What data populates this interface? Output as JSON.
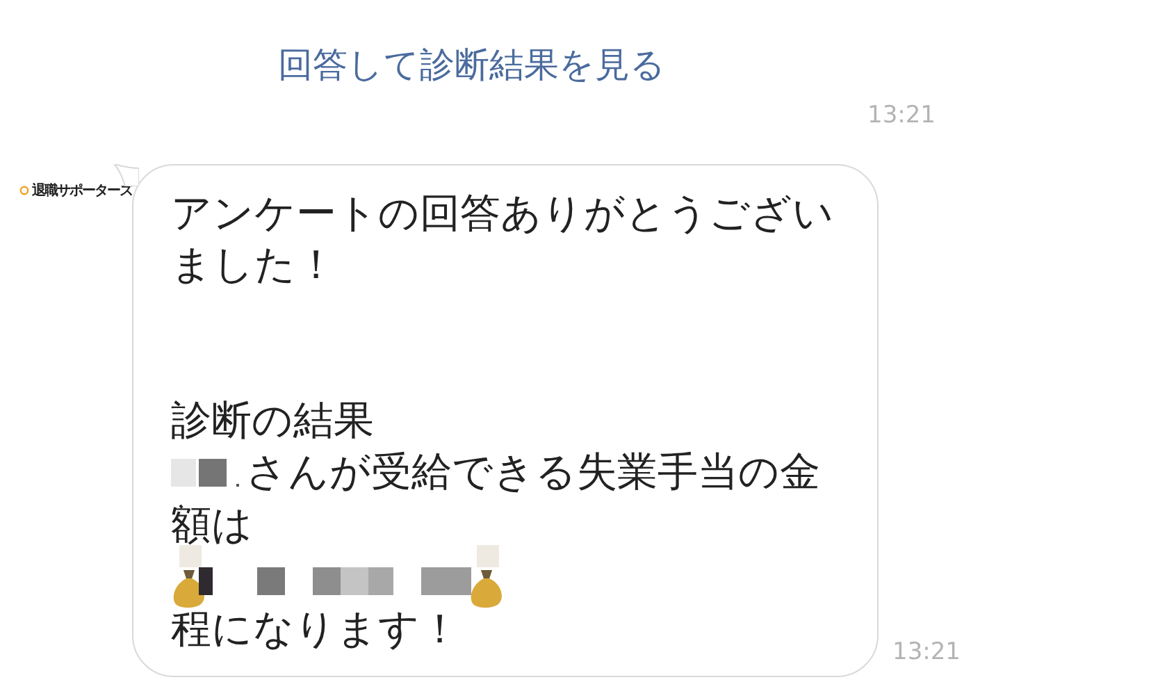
{
  "previous_message": {
    "link": "回答して診断結果を見る",
    "time": "13:21"
  },
  "message": {
    "sender": "退職サポーターズ",
    "lines": [
      {
        "kind": "text",
        "text": "アンケートの回答ありがとうござい"
      },
      {
        "kind": "text",
        "text": "ました！"
      },
      {
        "kind": "blank"
      },
      {
        "kind": "blank"
      },
      {
        "kind": "text",
        "text": "診断の結果"
      },
      {
        "kind": "mixed",
        "parts": [
          {
            "kind": "mosaic"
          },
          {
            "kind": "text",
            "text": "さんが受給できる失業手当の金"
          }
        ]
      },
      {
        "kind": "text",
        "text": "額は"
      },
      {
        "kind": "mixed",
        "parts": [
          {
            "kind": "money-bag"
          },
          {
            "kind": "mosaic-long"
          },
          {
            "kind": "money-bag"
          }
        ]
      },
      {
        "kind": "text",
        "text": "程になります！"
      }
    ],
    "time": "13:21"
  }
}
